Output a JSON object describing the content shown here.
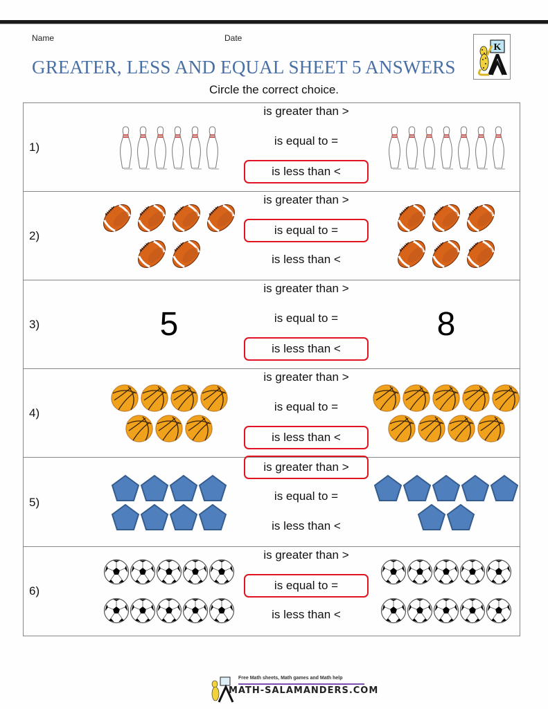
{
  "header": {
    "name_label": "Name",
    "date_label": "Date",
    "title": "GREATER, LESS AND EQUAL SHEET 5 ANSWERS",
    "instruction": "Circle the correct choice.",
    "logo_letter": "K",
    "title_color": "#4a6fa5"
  },
  "choice_labels": [
    "is greater than >",
    "is equal to =",
    "is less than <"
  ],
  "answer_circle_color": "#e0141e",
  "rows": [
    {
      "number": "1)",
      "kind": "bowling-pin",
      "left_count": 6,
      "right_count": 7,
      "left_layout": [
        6
      ],
      "right_layout": [
        7
      ],
      "answer_index": 2
    },
    {
      "number": "2)",
      "kind": "football",
      "left_count": 6,
      "right_count": 6,
      "left_layout": [
        4,
        2
      ],
      "right_layout": [
        3,
        3
      ],
      "answer_index": 1
    },
    {
      "number": "3)",
      "kind": "number",
      "left_value": "5",
      "right_value": "8",
      "answer_index": 2
    },
    {
      "number": "4)",
      "kind": "basketball",
      "left_count": 7,
      "right_count": 9,
      "left_layout": [
        4,
        3
      ],
      "right_layout": [
        5,
        4
      ],
      "answer_index": 2
    },
    {
      "number": "5)",
      "kind": "pentagon",
      "left_count": 8,
      "right_count": 7,
      "left_layout": [
        4,
        4
      ],
      "right_layout": [
        5,
        2
      ],
      "answer_index": 0
    },
    {
      "number": "6)",
      "kind": "soccer-ball",
      "left_count": 10,
      "right_count": 10,
      "left_layout": [
        5,
        5
      ],
      "right_layout": [
        5,
        5
      ],
      "answer_index": 1
    }
  ],
  "footer": {
    "tagline": "Free Math sheets, Math games and Math help",
    "site": "MATH-SALAMANDERS.COM"
  }
}
